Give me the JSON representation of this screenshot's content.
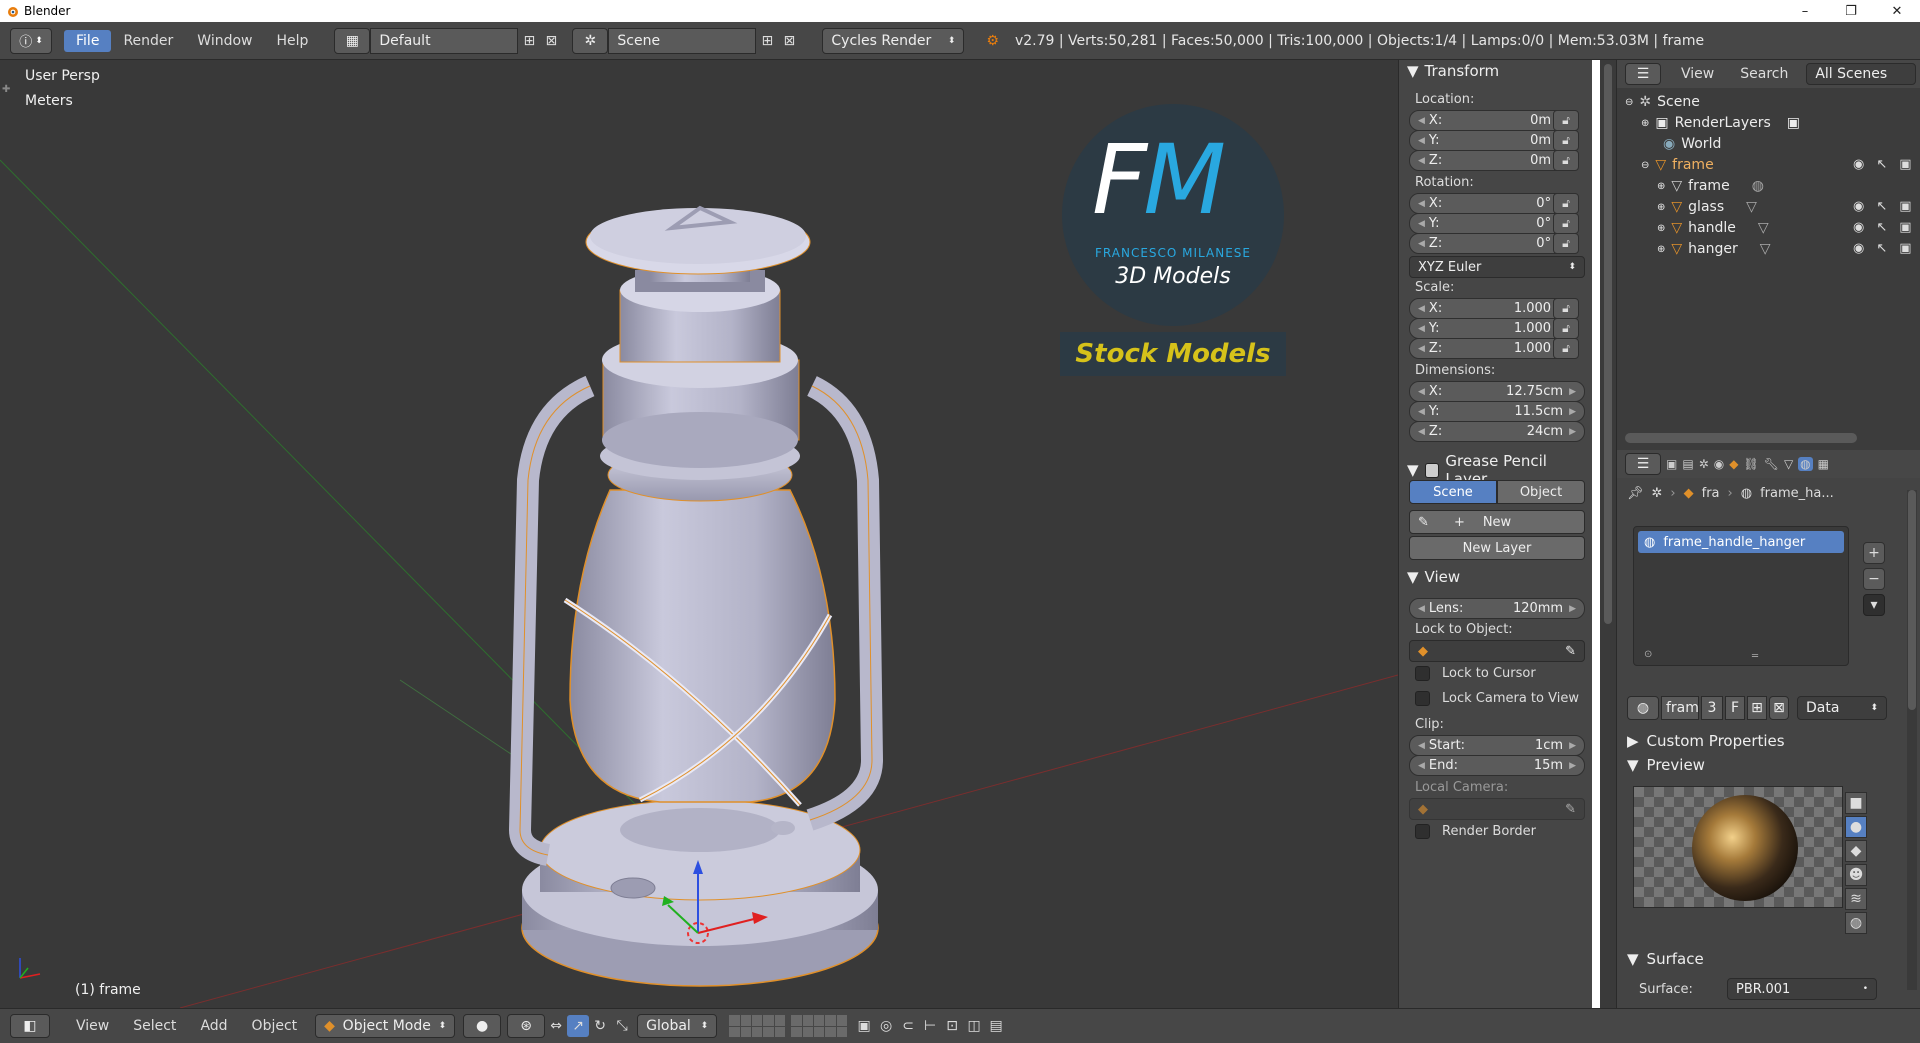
{
  "window": {
    "title": "Blender",
    "min": "–",
    "max": "❐",
    "close": "✕"
  },
  "topbar": {
    "menus": [
      "File",
      "Render",
      "Window",
      "Help"
    ],
    "screen_layout": "Default",
    "scene": "Scene",
    "render_engine": "Cycles Render",
    "stats": "v2.79 | Verts:50,281 | Faces:50,000 | Tris:100,000 | Objects:1/4 | Lamps:0/0 | Mem:53.03M | frame"
  },
  "viewport": {
    "view_name": "User Persp",
    "units": "Meters",
    "object_label": "(1) frame",
    "watermark": {
      "logo_text": "FM",
      "brand": "FRANCESCO MILANESE",
      "subtitle": "3D Models",
      "banner": "Stock Models"
    }
  },
  "npanel": {
    "transform": {
      "header": "Transform",
      "location_label": "Location:",
      "location": [
        {
          "axis": "X:",
          "value": "0m"
        },
        {
          "axis": "Y:",
          "value": "0m"
        },
        {
          "axis": "Z:",
          "value": "0m"
        }
      ],
      "rotation_label": "Rotation:",
      "rotation": [
        {
          "axis": "X:",
          "value": "0°"
        },
        {
          "axis": "Y:",
          "value": "0°"
        },
        {
          "axis": "Z:",
          "value": "0°"
        }
      ],
      "rotation_mode": "XYZ Euler",
      "scale_label": "Scale:",
      "scale": [
        {
          "axis": "X:",
          "value": "1.000"
        },
        {
          "axis": "Y:",
          "value": "1.000"
        },
        {
          "axis": "Z:",
          "value": "1.000"
        }
      ],
      "dimensions_label": "Dimensions:",
      "dimensions": [
        {
          "axis": "X:",
          "value": "12.75cm"
        },
        {
          "axis": "Y:",
          "value": "11.5cm"
        },
        {
          "axis": "Z:",
          "value": "24cm"
        }
      ]
    },
    "grease_pencil": {
      "header": "Grease Pencil Layer",
      "tab_scene": "Scene",
      "tab_object": "Object",
      "new_label": "New",
      "new_layer_label": "New Layer"
    },
    "view": {
      "header": "View",
      "lens_label": "Lens:",
      "lens_value": "120mm",
      "lock_to_object_label": "Lock to Object:",
      "lock_to_cursor": "Lock to Cursor",
      "lock_camera": "Lock Camera to View",
      "clip_label": "Clip:",
      "clip_start_label": "Start:",
      "clip_start": "1cm",
      "clip_end_label": "End:",
      "clip_end": "15m",
      "local_camera_label": "Local Camera:",
      "render_border": "Render Border"
    }
  },
  "outliner": {
    "header": {
      "view": "View",
      "search": "Search",
      "filter": "All Scenes"
    },
    "items": [
      {
        "label": "Scene"
      },
      {
        "label": "RenderLayers"
      },
      {
        "label": "World"
      },
      {
        "label": "frame"
      },
      {
        "label": "frame"
      },
      {
        "label": "glass"
      },
      {
        "label": "handle"
      },
      {
        "label": "hanger"
      }
    ]
  },
  "properties": {
    "breadcrumb_object": "fra",
    "breadcrumb_material": "frame_ha...",
    "material_slot": "frame_handle_hanger",
    "datablock_name": "fram",
    "datablock_users": "3",
    "datablock_fake": "F",
    "link_mode": "Data",
    "custom_properties": "Custom Properties",
    "preview_header": "Preview",
    "surface_header": "Surface",
    "surface_label": "Surface:",
    "surface_value": "PBR.001"
  },
  "bottombar": {
    "menus": [
      "View",
      "Select",
      "Add",
      "Object"
    ],
    "mode": "Object Mode",
    "orientation": "Global"
  },
  "colors": {
    "accent": "#5680c2",
    "viewport_bg": "#393939",
    "panel_bg": "#464646",
    "selection_outline": "#e0902a",
    "watermark_blue": "#29a8e0",
    "watermark_yellow": "#d6c21a"
  }
}
